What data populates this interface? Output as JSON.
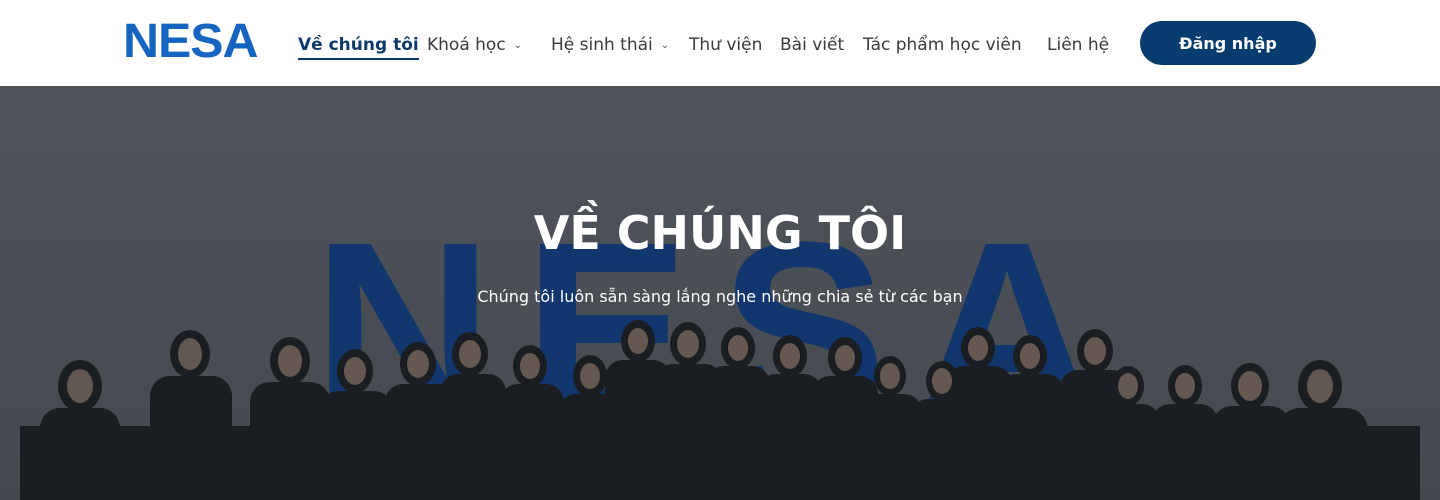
{
  "brand": {
    "logo_text": "NESA",
    "color": "#1565c0"
  },
  "nav": {
    "items": [
      {
        "label": "Về chúng tôi",
        "active": true,
        "has_dropdown": false
      },
      {
        "label": "Khoá học",
        "active": false,
        "has_dropdown": true
      },
      {
        "label": "Hệ sinh thái",
        "active": false,
        "has_dropdown": true
      },
      {
        "label": "Thư viện",
        "active": false,
        "has_dropdown": false
      },
      {
        "label": "Bài viết",
        "active": false,
        "has_dropdown": false
      },
      {
        "label": "Tác phẩm học viên",
        "active": false,
        "has_dropdown": false
      },
      {
        "label": "Liên hệ",
        "active": false,
        "has_dropdown": false
      }
    ],
    "caret_icon": "chevron-down-icon",
    "login_label": "Đăng nhập",
    "login_color": "#063d6e"
  },
  "hero": {
    "title": "VỀ CHÚNG TÔI",
    "subtitle": "Chúng tôi luôn sẵn sàng lắng nghe những chia sẻ từ các bạn",
    "backdrop_text": "NESA",
    "backdrop_color": "#0b3a82",
    "photo_description_icon": "team-group-photo"
  }
}
